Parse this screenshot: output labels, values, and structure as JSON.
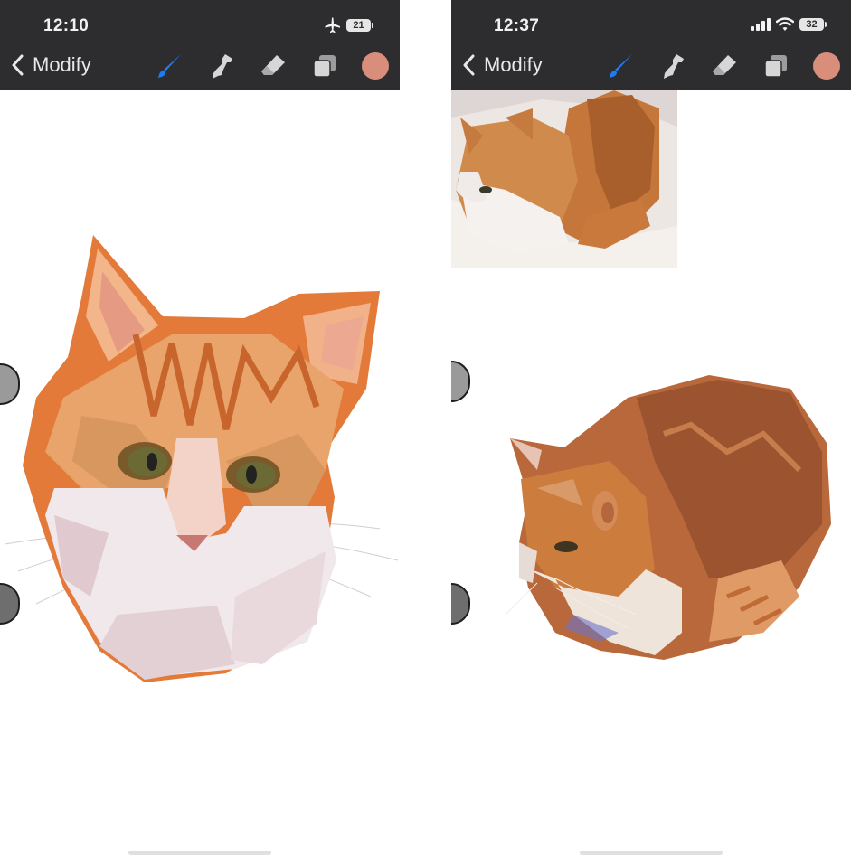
{
  "left_screen": {
    "time": "12:10",
    "battery": "21",
    "back_label": "Modify",
    "color_swatch": "#d98e7c",
    "tools": [
      "brush-icon",
      "smudge-icon",
      "eraser-icon",
      "layers-icon"
    ]
  },
  "right_screen": {
    "time": "12:37",
    "battery": "32",
    "back_label": "Modify",
    "color_swatch": "#d98e7c",
    "tools": [
      "brush-icon",
      "smudge-icon",
      "eraser-icon",
      "layers-icon"
    ]
  },
  "colors": {
    "toolbar_bg": "#2d2d2f",
    "active_tool": "#1e7af5",
    "inactive_tool": "#d6d6d6"
  }
}
